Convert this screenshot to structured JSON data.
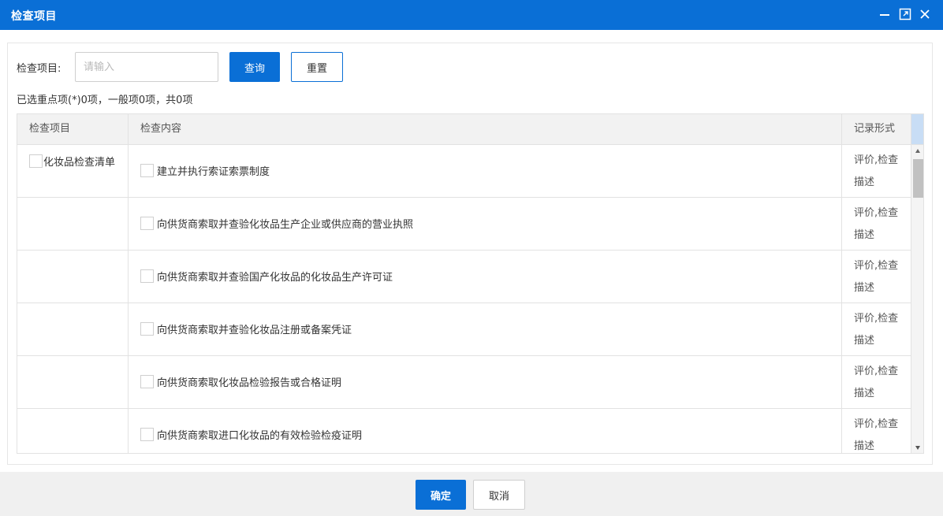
{
  "window": {
    "title": "检查项目",
    "accent_color": "#0a6fd6",
    "controls": [
      "minimize-icon",
      "maximize-icon",
      "close-icon"
    ]
  },
  "search": {
    "label": "检查项目:",
    "placeholder": "请输入",
    "value": "",
    "query_label": "查询",
    "reset_label": "重置"
  },
  "summary": "已选重点项(*)0项，一般项0项，共0项",
  "table": {
    "headers": [
      "检查项目",
      "检查内容",
      "记录形式"
    ],
    "category": "化妆品检查清单",
    "rows": [
      {
        "content": "建立并执行索证索票制度",
        "record": "评价,检查描述"
      },
      {
        "content": "向供货商索取并查验化妆品生产企业或供应商的营业执照",
        "record": "评价,检查描述"
      },
      {
        "content": "向供货商索取并查验国产化妆品的化妆品生产许可证",
        "record": "评价,检查描述"
      },
      {
        "content": "向供货商索取并查验化妆品注册或备案凭证",
        "record": "评价,检查描述"
      },
      {
        "content": "向供货商索取化妆品检验报告或合格证明",
        "record": "评价,检查描述"
      },
      {
        "content": "向供货商索取进口化妆品的有效检验检疫证明",
        "record": "评价,检查描述"
      }
    ]
  },
  "footer": {
    "ok_label": "确定",
    "cancel_label": "取消"
  }
}
